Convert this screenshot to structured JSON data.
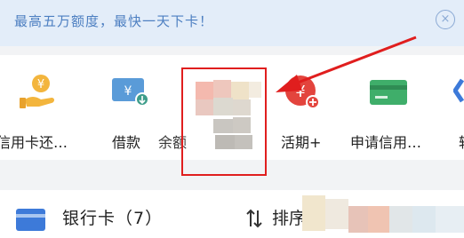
{
  "banner": {
    "text": "最高五万额度，最快一天下卡！",
    "close_glyph": "×"
  },
  "quick_actions": [
    {
      "label": "信用卡还…",
      "icon": "hand-coin-icon"
    },
    {
      "label": "借款",
      "icon": "yuan-card-icon"
    },
    {
      "label": "余额",
      "icon": "blurred-icon"
    },
    {
      "label": "活期+",
      "icon": "yuan-plus-icon"
    },
    {
      "label": "申请信用…",
      "icon": "credit-card-icon"
    },
    {
      "label": "转",
      "icon": "arrow-icon"
    }
  ],
  "bank_section": {
    "label": "银行卡（7）",
    "sort_label": "排序",
    "icon": "bank-card-icon",
    "sort_icon": "sort-arrows-icon"
  },
  "annotation": {
    "box_color": "#e01e1e",
    "arrow_color": "#e01e1e"
  },
  "colors": {
    "banner_bg": "#e3edf9",
    "banner_text": "#4d7fc1",
    "accent_blue": "#3d7ad9",
    "page_bg": "#f2f3f5"
  }
}
